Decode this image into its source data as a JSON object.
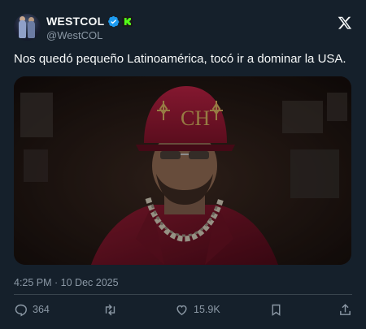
{
  "author": {
    "display_name": "WESTCOL",
    "handle": "@WestCOL",
    "verified_icon": "verified-badge-icon",
    "affiliate_icon": "kick-logo-icon"
  },
  "platform_icon": "x-logo-icon",
  "tweet": {
    "text": "Nos quedó pequeño Latinoamérica, tocó ir a dominar la USA.",
    "timestamp": "4:25 PM · 10 Dec 2025"
  },
  "actions": {
    "replies": "364",
    "retweets": "",
    "likes": "15.9K"
  },
  "colors": {
    "background": "#15202b",
    "text_primary": "#f7f9f9",
    "text_secondary": "#8b98a5",
    "verified_blue": "#1d9bf0",
    "kick_green": "#53fc18",
    "divider": "#38444d"
  }
}
